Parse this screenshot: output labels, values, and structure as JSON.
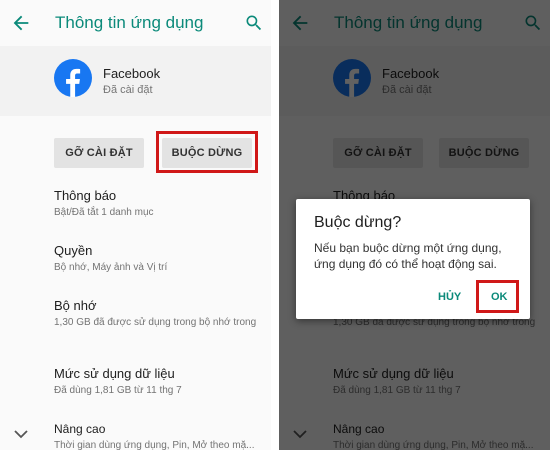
{
  "colors": {
    "accent": "#0b8a7a",
    "highlight": "#d01818",
    "facebook_blue": "#1877f2"
  },
  "app_info": {
    "title": "Thông tin ứng dụng",
    "app_name": "Facebook",
    "app_status": "Đã cài đặt",
    "uninstall_label": "GỠ CÀI ĐẶT",
    "force_stop_label": "BUỘC DỪNG",
    "items": [
      {
        "title": "Thông báo",
        "subtitle": "Bật/Đã tắt 1 danh mục"
      },
      {
        "title": "Quyền",
        "subtitle": "Bộ nhớ, Máy ảnh và Vị trí"
      },
      {
        "title": "Bộ nhớ",
        "subtitle": "1,30 GB đã được sử dụng trong bộ nhớ trong"
      },
      {
        "title": "Mức sử dụng dữ liệu",
        "subtitle": "Đã dùng 1,81 GB từ 11 thg 7"
      },
      {
        "title": "Nâng cao",
        "subtitle": "Thời gian dùng ứng dụng, Pin, Mở theo mặ..."
      }
    ],
    "icons": {
      "back": "arrow-left-icon",
      "search": "search-icon",
      "expand": "chevron-down-icon",
      "app": "facebook-icon"
    }
  },
  "dialog": {
    "title": "Buộc dừng?",
    "message": "Nếu bạn buộc dừng một ứng dụng, ứng dụng đó có thể hoạt động sai.",
    "cancel_label": "HỦY",
    "ok_label": "OK"
  }
}
